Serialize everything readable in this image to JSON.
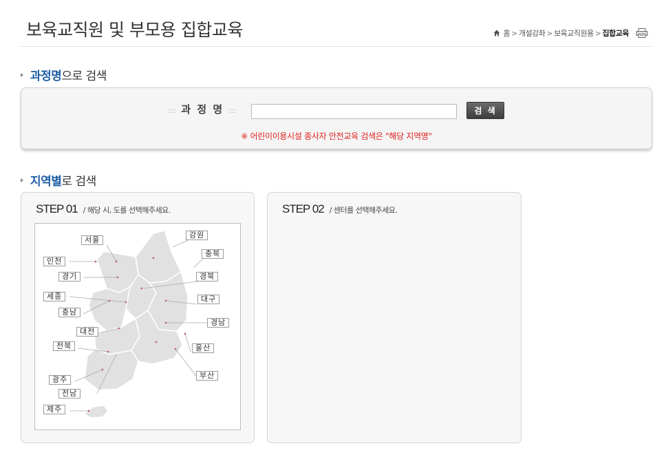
{
  "header": {
    "title": "보육교직원 및 부모용 집합교육",
    "breadcrumb": [
      "홈",
      "개설강좌",
      "보육교직원용",
      "집합교육"
    ],
    "breadcrumb_separator": ">"
  },
  "search_section": {
    "heading_accent": "과정명",
    "heading_rest": "으로 검색",
    "label_dots_left": ":::",
    "label": "과 정 명",
    "label_dots_right": ":::",
    "input_value": "",
    "button_label": "검 색",
    "notice": "※ 어린이이용시설 종사자 안전교육 검색은 \"해당 지역명\""
  },
  "region_section": {
    "heading_accent": "지역별",
    "heading_rest": "로 검색",
    "step1": {
      "title": "STEP 01",
      "description": "/ 해당 시, 도를 선택해주세요.",
      "regions": [
        "서울",
        "강원",
        "인천",
        "충북",
        "경기",
        "경북",
        "세종",
        "대구",
        "충남",
        "경남",
        "대전",
        "울산",
        "전북",
        "부산",
        "광주",
        "전남",
        "제주"
      ]
    },
    "step2": {
      "title": "STEP 02",
      "description": "/ 센터를 선택해주세요."
    }
  },
  "colors": {
    "accent": "#1f5fa5",
    "notice": "#e02020",
    "button": "#4a4a4a",
    "map_land": "#e2e2e2"
  }
}
